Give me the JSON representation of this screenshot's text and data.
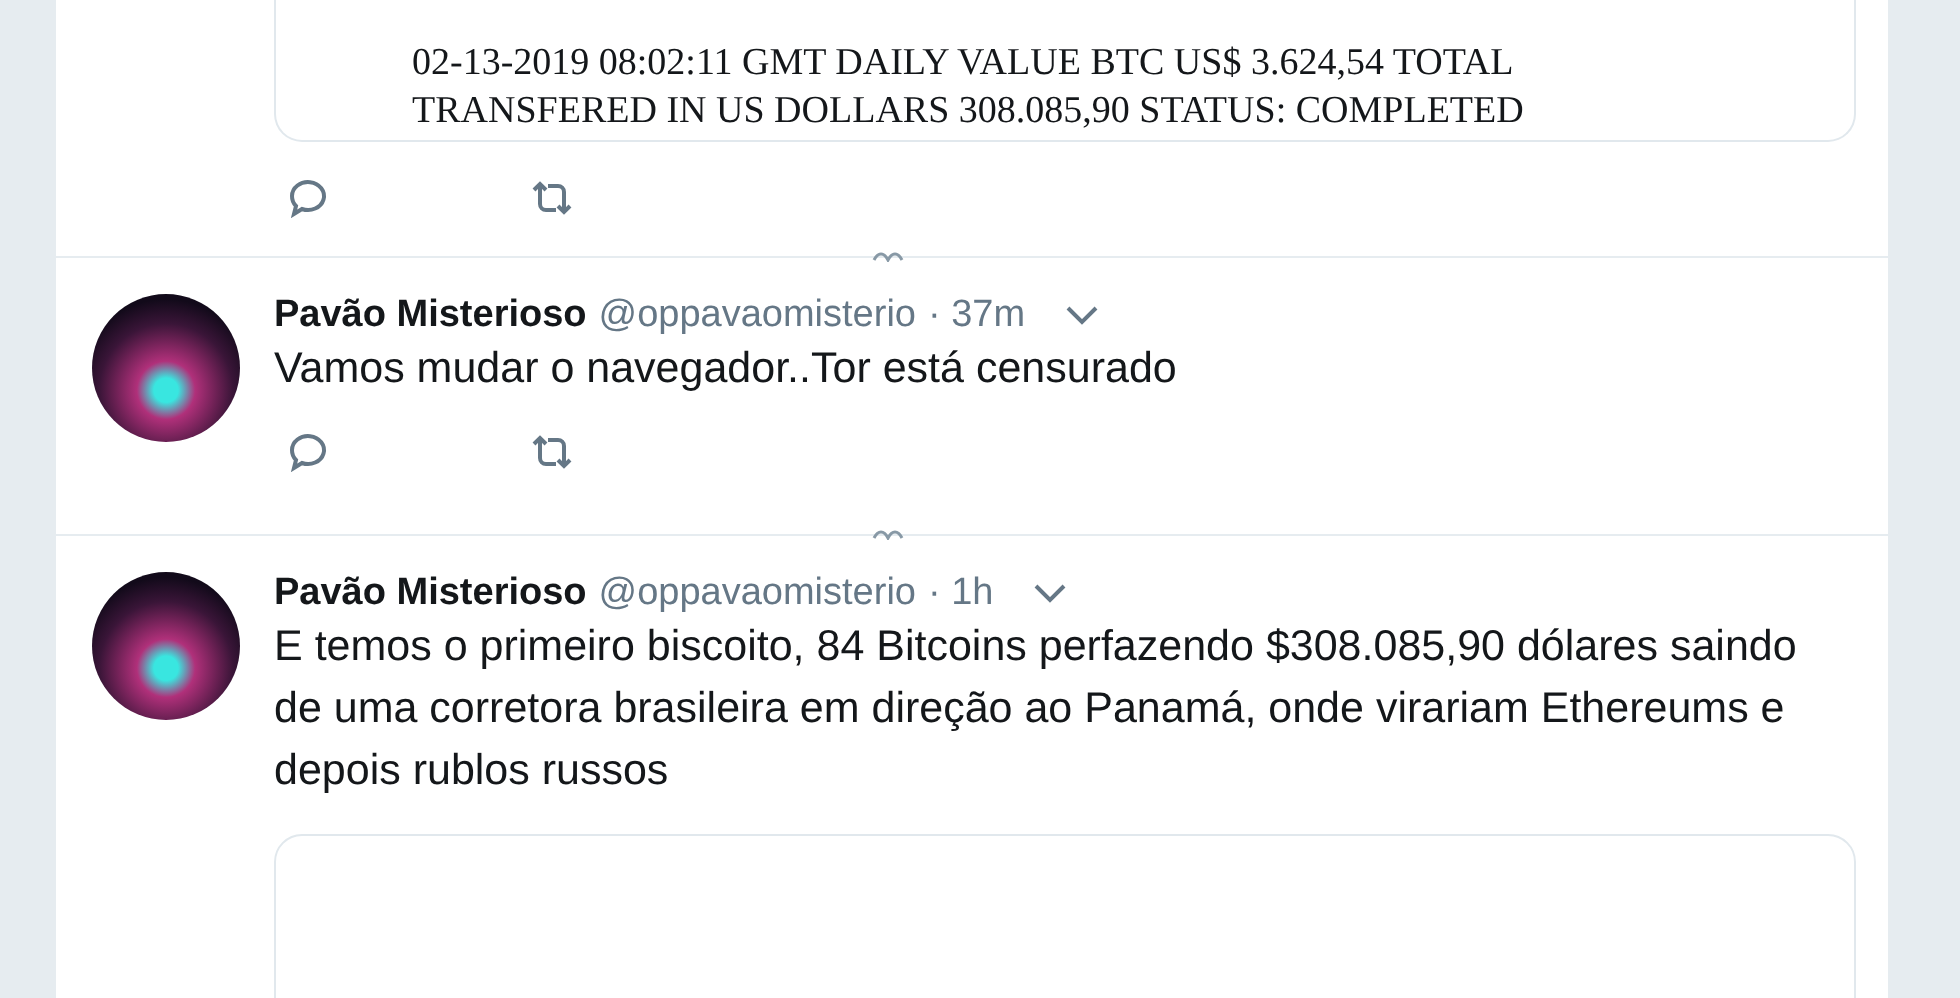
{
  "quoted_card": {
    "lines": [
      "02-13-2019 08:02:11 GMT  DAILY VALUE BTC US$ 3.624,54 TOTAL",
      "TRANSFERED IN US DOLLARS 308.085,90 STATUS: COMPLETED"
    ]
  },
  "tweets": [
    {
      "name": "Pavão Misterioso",
      "handle": "@oppavaomisterio",
      "time": "· 37m",
      "text": "Vamos mudar o navegador..Tor está censurado",
      "show_actions": true,
      "show_card": false
    },
    {
      "name": "Pavão Misterioso",
      "handle": "@oppavaomisterio",
      "time": "· 1h",
      "text": "E temos o primeiro biscoito, 84 Bitcoins perfazendo $308.085,90 dólares saindo de uma corretora brasileira em direção ao Panamá, onde virariam Ethereums e depois rublos russos",
      "show_actions": false,
      "show_card": true
    }
  ]
}
